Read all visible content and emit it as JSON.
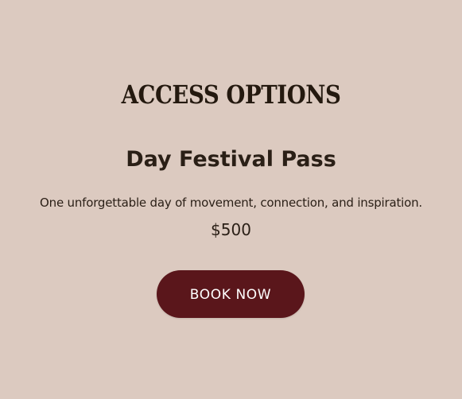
{
  "section": {
    "heading": "ACCESS OPTIONS"
  },
  "pass": {
    "title": "Day Festival Pass",
    "description": "One unforgettable day of movement, connection, and inspiration.",
    "price": "$500",
    "cta_label": "BOOK NOW"
  },
  "colors": {
    "background": "#dccac0",
    "text": "#2a1f16",
    "button": "#5a161b",
    "button_text": "#ffffff"
  }
}
